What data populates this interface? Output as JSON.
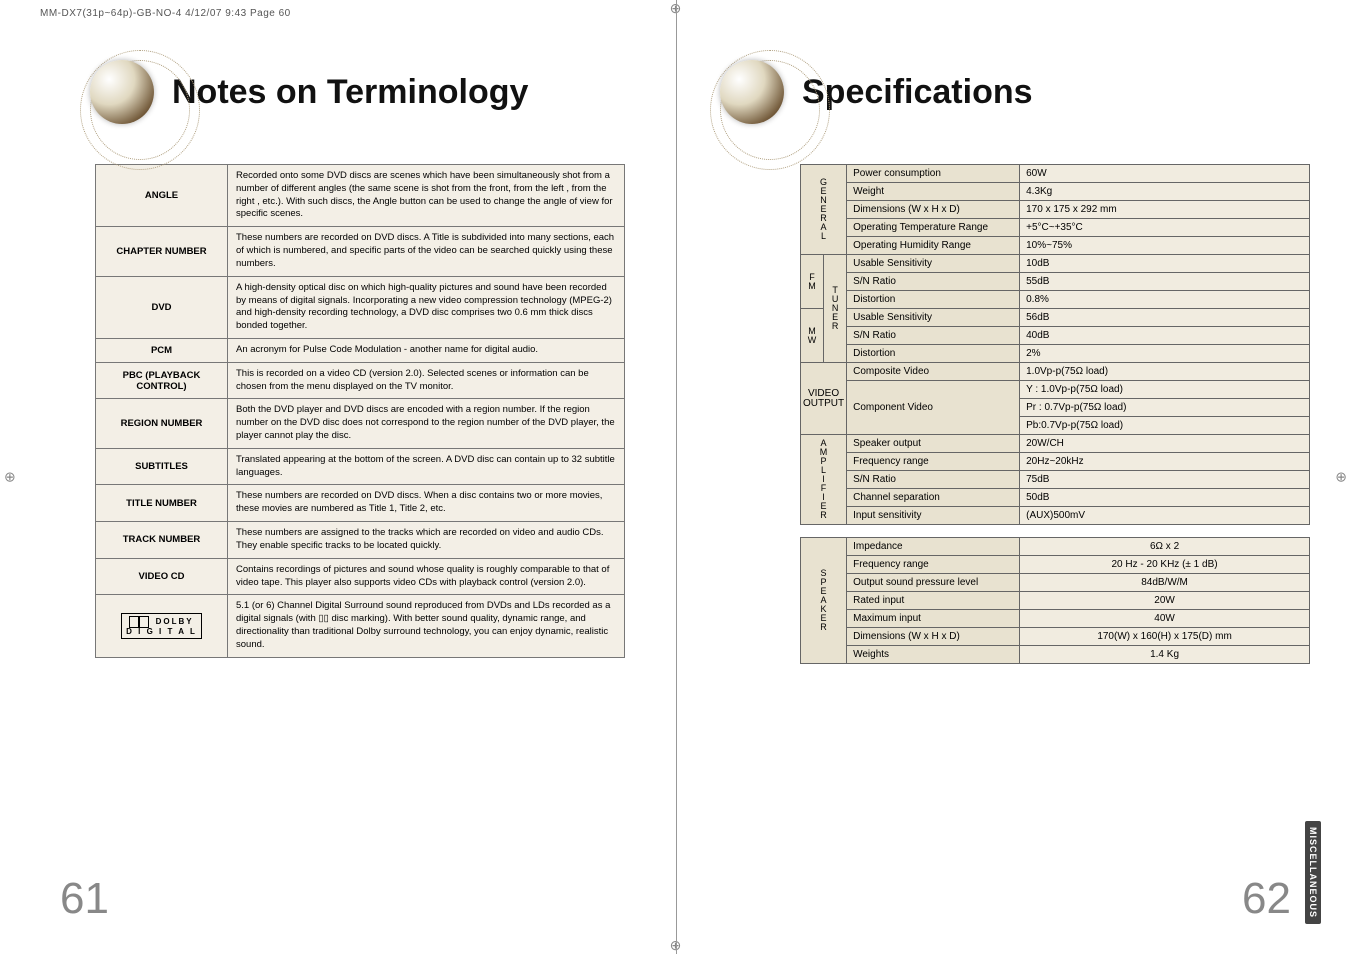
{
  "header_line": "MM-DX7(31p~64p)-GB-NO-4  4/12/07  9:43  Page 60",
  "left_page": {
    "title": "Notes on Terminology",
    "rows": [
      {
        "label": "ANGLE",
        "desc": "Recorded onto some DVD discs are scenes which have been simultaneously shot from a number of different angles (the same scene is shot from the front, from the left , from the right , etc.).\nWith such discs, the Angle button can be used to change the angle of view for specific scenes."
      },
      {
        "label": "CHAPTER NUMBER",
        "desc": "These numbers are recorded on DVD discs. A Title is subdivided into many sections, each of which is numbered, and specific parts of the video can be searched quickly using these numbers."
      },
      {
        "label": "DVD",
        "desc": "A high-density optical disc on which high-quality pictures and sound have been recorded by means of digital signals. Incorporating a new video compression technology (MPEG-2) and high-density recording technology, a DVD disc comprises  two 0.6 mm thick discs bonded together."
      },
      {
        "label": "PCM",
        "desc": "An acronym for Pulse Code Modulation - another name for digital audio."
      },
      {
        "label": "PBC (PLAYBACK CONTROL)",
        "desc": "This is recorded on a video CD (version 2.0). Selected scenes or information can be chosen from the menu displayed on the TV monitor."
      },
      {
        "label": "REGION NUMBER",
        "desc": "Both the DVD player and DVD discs are encoded with a region number.\nIf the region number on the DVD disc does not correspond to the region number of the DVD player, the player cannot play the disc."
      },
      {
        "label": "SUBTITLES",
        "desc": "Translated appearing at the bottom of the screen. A DVD disc can contain up to 32 subtitle languages."
      },
      {
        "label": "TITLE NUMBER",
        "desc": "These numbers are recorded on DVD discs.  When a disc contains two or more movies, these movies are numbered as Title 1, Title 2, etc."
      },
      {
        "label": "TRACK NUMBER",
        "desc": "These numbers are assigned to the tracks which are recorded on video and audio CDs. They enable specific tracks to be located quickly."
      },
      {
        "label": "VIDEO CD",
        "desc": "Contains recordings of pictures and sound whose quality is roughly comparable to that of video tape.\nThis player also supports video CDs with playback control (version 2.0)."
      },
      {
        "label": "DOLBY_LOGO",
        "desc": "5.1 (or 6) Channel Digital Surround sound reproduced from DVDs and LDs recorded as a digital signals (with ▯▯  disc marking). With better sound quality, dynamic range, and directionality than traditional Dolby surround technology, you can enjoy dynamic, realistic sound."
      }
    ],
    "dolby": {
      "top": "DOLBY",
      "bottom": "D I G I T A L"
    },
    "page_num": "61"
  },
  "right_page": {
    "title": "Specifications",
    "side_tab": "MISCELLANEOUS",
    "page_num": "62",
    "general_label": "GENERAL",
    "general": [
      {
        "k": "Power consumption",
        "v": "60W"
      },
      {
        "k": "Weight",
        "v": "4.3Kg"
      },
      {
        "k": "Dimensions (W x H x D)",
        "v": "170 x 175 x 292 mm"
      },
      {
        "k": "Operating Temperature Range",
        "v": "+5°C~+35°C"
      },
      {
        "k": "Operating Humidity Range",
        "v": "10%~75%"
      }
    ],
    "fm_label": "FM",
    "mw_label": "MW",
    "tuner_label": "TUNER",
    "fm": [
      {
        "k": "Usable Sensitivity",
        "v": "10dB"
      },
      {
        "k": "S/N Ratio",
        "v": "55dB"
      },
      {
        "k": "Distortion",
        "v": "0.8%"
      }
    ],
    "mw": [
      {
        "k": "Usable Sensitivity",
        "v": "56dB"
      },
      {
        "k": "S/N Ratio",
        "v": "40dB"
      },
      {
        "k": "Distortion",
        "v": "2%"
      }
    ],
    "video_label": "VIDEO OUTPUT",
    "video": [
      {
        "k": "Composite Video",
        "v": "1.0Vp-p(75Ω load)"
      },
      {
        "k": "Component Video",
        "v": "Y : 1.0Vp-p(75Ω load)"
      },
      {
        "k": "",
        "v": "Pr : 0.7Vp-p(75Ω load)"
      },
      {
        "k": "",
        "v": "Pb:0.7Vp-p(75Ω load)"
      }
    ],
    "amp_label": "AMPLIFIER",
    "amp": [
      {
        "k": "Speaker output",
        "v": "20W/CH"
      },
      {
        "k": "Frequency range",
        "v": "20Hz~20kHz"
      },
      {
        "k": "S/N Ratio",
        "v": "75dB"
      },
      {
        "k": "Channel separation",
        "v": "50dB"
      },
      {
        "k": "Input sensitivity",
        "v": "(AUX)500mV"
      }
    ],
    "spk_label": "SPEAKER",
    "spk": [
      {
        "k": "Impedance",
        "v": "6Ω x 2"
      },
      {
        "k": "Frequency range",
        "v": "20 Hz - 20 KHz (± 1 dB)"
      },
      {
        "k": "Output sound pressure level",
        "v": "84dB/W/M"
      },
      {
        "k": "Rated input",
        "v": "20W"
      },
      {
        "k": "Maximum input",
        "v": "40W"
      },
      {
        "k": "Dimensions  (W x H x D)",
        "v": "170(W) x 160(H) x 175(D) mm"
      },
      {
        "k": "Weights",
        "v": "1.4 Kg"
      }
    ]
  }
}
